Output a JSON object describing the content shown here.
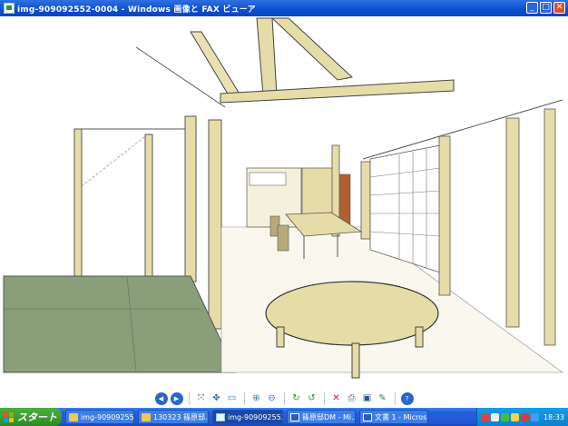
{
  "window": {
    "title": "img-909092552-0004 - Windows 画像と FAX ビューア",
    "minimize_glyph": "_",
    "maximize_glyph": "□",
    "close_glyph": "✕"
  },
  "viewer": {
    "image_alt": "室内パース スケッチ",
    "toolbar": [
      {
        "name": "prev-image-button",
        "icon": "prev-icon",
        "glyph": "◀"
      },
      {
        "name": "next-image-button",
        "icon": "next-icon",
        "glyph": "▶"
      },
      {
        "name": "best-fit-button",
        "icon": "best-fit-icon",
        "glyph": "⤧"
      },
      {
        "name": "actual-size-button",
        "icon": "actual-size-icon",
        "glyph": "✥"
      },
      {
        "name": "slideshow-button",
        "icon": "slideshow-icon",
        "glyph": "▭"
      },
      {
        "name": "zoom-in-button",
        "icon": "zoom-in-icon",
        "glyph": "⊕"
      },
      {
        "name": "zoom-out-button",
        "icon": "zoom-out-icon",
        "glyph": "⊖"
      },
      {
        "name": "rotate-cw-button",
        "icon": "rotate-cw-icon",
        "glyph": "↻"
      },
      {
        "name": "rotate-ccw-button",
        "icon": "rotate-ccw-icon",
        "glyph": "↺"
      },
      {
        "name": "delete-button",
        "icon": "delete-icon",
        "glyph": "✕"
      },
      {
        "name": "print-button",
        "icon": "print-icon",
        "glyph": "⎙"
      },
      {
        "name": "save-button",
        "icon": "save-icon",
        "glyph": "▣"
      },
      {
        "name": "edit-button",
        "icon": "edit-icon",
        "glyph": "✎"
      },
      {
        "name": "help-button",
        "icon": "help-icon",
        "glyph": "?"
      }
    ]
  },
  "taskbar": {
    "start_label": "スタート",
    "tasks": [
      {
        "label": "img-909092552",
        "icon": "folder-icon",
        "active": false
      },
      {
        "label": "130323 篠原邸...",
        "icon": "folder-icon",
        "active": false
      },
      {
        "label": "img-909092552...",
        "icon": "image-viewer-icon",
        "active": true
      },
      {
        "label": "篠原邸DM - Mi...",
        "icon": "word-icon",
        "active": false
      },
      {
        "label": "文書 1 - Micros...",
        "icon": "word-icon",
        "active": false
      }
    ],
    "tray_icons": [
      "ime-icon",
      "language-bar-icon",
      "network-icon",
      "volume-icon",
      "security-icon",
      "update-icon"
    ],
    "clock": "18:33"
  },
  "colors": {
    "titlebar": "#0b4fd0",
    "taskbar": "#245edb",
    "start_button": "#3a9a32",
    "tatami": "#8a9e7a",
    "wood": "#e6dca8"
  }
}
